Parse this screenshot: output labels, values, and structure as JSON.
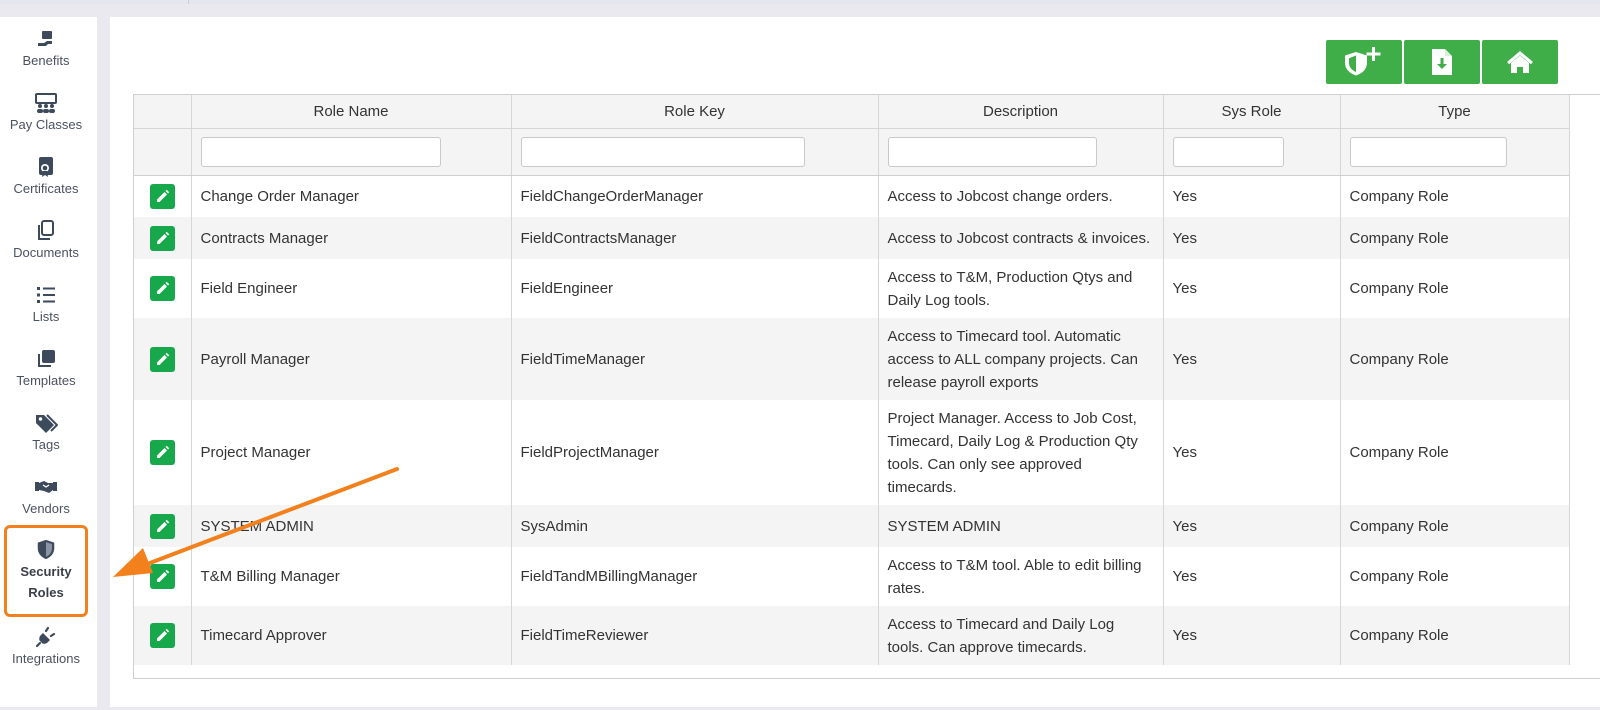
{
  "sidebar": {
    "items": [
      {
        "label": "Benefits",
        "icon": "benefits-icon"
      },
      {
        "label": "Pay Classes",
        "icon": "pay-classes-icon"
      },
      {
        "label": "Certificates",
        "icon": "certificate-icon"
      },
      {
        "label": "Documents",
        "icon": "documents-icon"
      },
      {
        "label": "Lists",
        "icon": "list-icon"
      },
      {
        "label": "Templates",
        "icon": "templates-icon"
      },
      {
        "label": "Tags",
        "icon": "tags-icon"
      },
      {
        "label": "Vendors",
        "icon": "handshake-icon"
      },
      {
        "label_line1": "Security",
        "label_line2": "Roles",
        "icon": "shield-icon",
        "active": true
      },
      {
        "label": "Integrations",
        "icon": "plug-icon"
      }
    ]
  },
  "toolbar": {
    "buttons": [
      "add-role-shield-icon",
      "export-file-icon",
      "home-icon"
    ],
    "color": "#3fae49"
  },
  "table": {
    "columns": [
      "Role Name",
      "Role Key",
      "Description",
      "Sys Role",
      "Type"
    ],
    "rows": [
      {
        "name": "Change Order Manager",
        "key": "FieldChangeOrderManager",
        "description": "Access to Jobcost change orders.",
        "sys": "Yes",
        "type": "Company Role"
      },
      {
        "name": "Contracts Manager",
        "key": "FieldContractsManager",
        "description": "Access to Jobcost contracts & invoices.",
        "sys": "Yes",
        "type": "Company Role"
      },
      {
        "name": "Field Engineer",
        "key": "FieldEngineer",
        "description": "Access to T&M, Production Qtys and Daily Log tools.",
        "sys": "Yes",
        "type": "Company Role"
      },
      {
        "name": "Payroll Manager",
        "key": "FieldTimeManager",
        "description": "Access to Timecard tool. Automatic access to ALL company projects. Can release payroll exports",
        "sys": "Yes",
        "type": "Company Role"
      },
      {
        "name": "Project Manager",
        "key": "FieldProjectManager",
        "description": "Project Manager. Access to Job Cost, Timecard, Daily Log & Production Qty tools. Can only see approved timecards.",
        "sys": "Yes",
        "type": "Company Role"
      },
      {
        "name": "SYSTEM ADMIN",
        "key": "SysAdmin",
        "description": "SYSTEM ADMIN",
        "sys": "Yes",
        "type": "Company Role"
      },
      {
        "name": "T&M Billing Manager",
        "key": "FieldTandMBillingManager",
        "description": "Access to T&M tool. Able to edit billing rates.",
        "sys": "Yes",
        "type": "Company Role"
      },
      {
        "name": "Timecard Approver",
        "key": "FieldTimeReviewer",
        "description": "Access to Timecard and Daily Log tools. Can approve timecards.",
        "sys": "Yes",
        "type": "Company Role"
      }
    ]
  },
  "colors": {
    "edit_button": "#17a84b",
    "highlight": "#f2801d"
  }
}
